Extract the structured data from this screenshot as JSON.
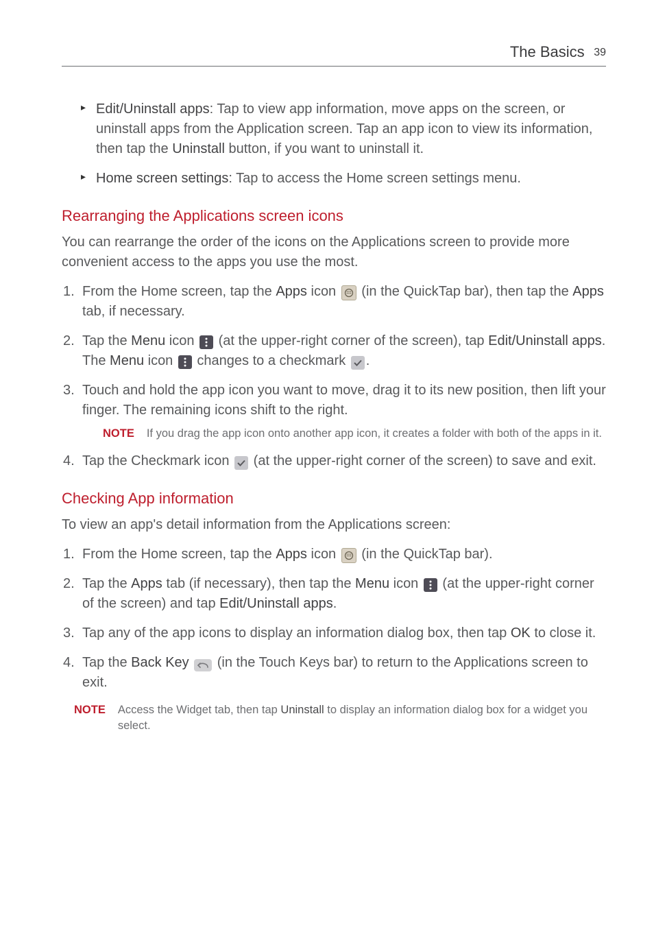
{
  "header": {
    "title": "The Basics",
    "page": "39"
  },
  "bullets": {
    "b1_bold": "Edit/Uninstall apps",
    "b1_a": ": Tap to view app information, move apps on the screen, or uninstall apps from the Application screen. Tap an app icon to view its information, then tap the ",
    "b1_uninstall": "Uninstall",
    "b1_b": " button, if you want to uninstall it.",
    "b2_bold": "Home screen settings",
    "b2_a": ": Tap to access the Home screen settings menu."
  },
  "sec1": {
    "title": "Rearranging the Applications screen icons",
    "intro": "You can rearrange the order of the icons on the Applications screen to provide more convenient access to the apps you use the most.",
    "s1_a": "From the Home screen, tap the ",
    "s1_apps": "Apps",
    "s1_b": " icon ",
    "s1_c": " (in the QuickTap bar), then tap the ",
    "s1_apps2": "Apps",
    "s1_d": " tab, if necessary.",
    "s2_a": "Tap the ",
    "s2_menu": "Menu",
    "s2_b": " icon ",
    "s2_c": " (at the upper-right corner of the screen), tap ",
    "s2_edit": "Edit/Uninstall apps",
    "s2_d": ". The ",
    "s2_menu2": "Menu",
    "s2_e": " icon ",
    "s2_f": " changes to a checkmark ",
    "s2_g": ".",
    "s3": "Touch and hold the app icon you want to move, drag it to its new position, then lift your finger. The remaining icons shift to the right.",
    "note_label": "NOTE",
    "note_text": "If you drag the app icon onto another app icon, it creates a folder with both of the apps in it.",
    "s4_a": "Tap the Checkmark icon ",
    "s4_b": " (at the upper-right corner of the screen) to save and exit."
  },
  "sec2": {
    "title": "Checking App information",
    "intro": "To view an app's detail information from the Applications screen:",
    "s1_a": "From the Home screen, tap the ",
    "s1_apps": "Apps",
    "s1_b": " icon ",
    "s1_c": " (in the QuickTap bar).",
    "s2_a": "Tap the ",
    "s2_apps": "Apps",
    "s2_b": " tab (if necessary), then tap the ",
    "s2_menu": "Menu",
    "s2_c": " icon ",
    "s2_d": " (at the upper-right corner of the screen) and tap ",
    "s2_edit": "Edit/Uninstall apps",
    "s2_e": ".",
    "s3_a": "Tap any of the app icons to display an information dialog box, then tap ",
    "s3_ok": "OK",
    "s3_b": " to close it.",
    "s4_a": "Tap the ",
    "s4_back": "Back Key",
    "s4_b": " ",
    "s4_c": " (in the Touch Keys bar) to return to the Applications screen to exit.",
    "note_label": "NOTE",
    "note_a": "Access the Widget tab, then tap ",
    "note_uninstall": "Uninstall",
    "note_b": " to display an information dialog box for a widget you select."
  },
  "nums": {
    "n1": "1.",
    "n2": "2.",
    "n3": "3.",
    "n4": "4."
  }
}
